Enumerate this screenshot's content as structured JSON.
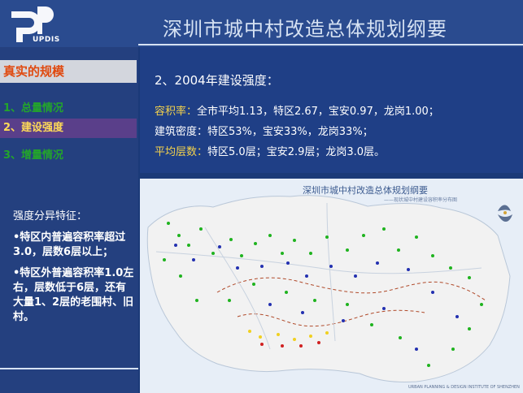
{
  "header": {
    "title": "深圳市城中村改造总体规划纲要",
    "logo_text": "UPDIS"
  },
  "sidebar": {
    "section": "真实的规模",
    "items": [
      {
        "label": "1、总量情况",
        "active": false
      },
      {
        "label": "2、建设强度",
        "active": true
      },
      {
        "label": "3、增量情况",
        "active": false
      }
    ],
    "notes_title": "强度分异特征：",
    "notes": [
      "•特区内普遍容积率超过3.0，层数6层以上；",
      "•特区外普遍容积率1.0左右，层数低于6层，还有大量1、2层的老围村、旧村。"
    ]
  },
  "main": {
    "heading": "2、2004年建设强度：",
    "lines": [
      {
        "key": "容积率：",
        "text": "全市平均1.13，特区2.67，宝安0.97，龙岗1.00；"
      },
      {
        "key": "",
        "text": "建筑密度：特区53%，宝安33%，龙岗33%；"
      },
      {
        "key": "平均层数：",
        "text": "特区5.0层；宝安2.9层；龙岗3.0层。"
      }
    ]
  },
  "map": {
    "title": "深圳市城中村改造总体规划纲要",
    "subtitle": "——现状城中村建设容积率分布图",
    "footer": "URBAN PLANNING & DESIGN INSTITUTE OF SHENZHEN",
    "colors": {
      "land": "#f2f2f2",
      "water": "#e7eef7",
      "dots_green": "#1fb31f",
      "dots_blue": "#2330b0",
      "dots_yellow": "#f0d020",
      "dots_red": "#d02020"
    }
  }
}
